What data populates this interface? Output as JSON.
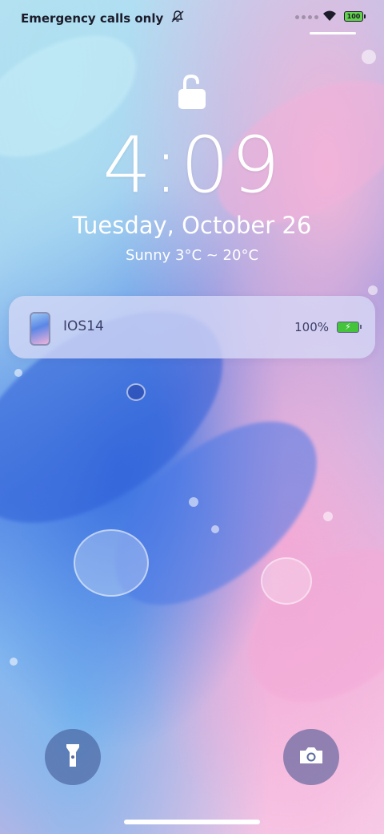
{
  "status_bar": {
    "carrier": "Emergency calls only",
    "battery_level": "100"
  },
  "lockscreen": {
    "time": "4:09",
    "date": "Tuesday, October 26",
    "weather": "Sunny  3°C ~ 20°C"
  },
  "notification": {
    "title": "IOS14",
    "battery_percent": "100%"
  },
  "icons": {
    "lock": "unlocked-padlock-icon",
    "flashlight": "flashlight-icon",
    "camera": "camera-icon"
  }
}
